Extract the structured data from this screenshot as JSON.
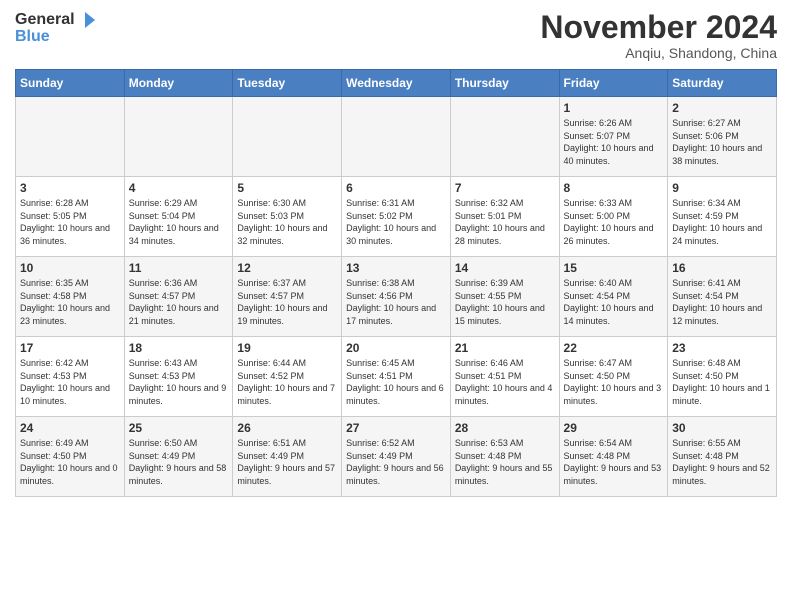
{
  "header": {
    "logo_line1": "General",
    "logo_line2": "Blue",
    "month_title": "November 2024",
    "subtitle": "Anqiu, Shandong, China"
  },
  "days_of_week": [
    "Sunday",
    "Monday",
    "Tuesday",
    "Wednesday",
    "Thursday",
    "Friday",
    "Saturday"
  ],
  "weeks": [
    [
      {
        "day": "",
        "info": ""
      },
      {
        "day": "",
        "info": ""
      },
      {
        "day": "",
        "info": ""
      },
      {
        "day": "",
        "info": ""
      },
      {
        "day": "",
        "info": ""
      },
      {
        "day": "1",
        "info": "Sunrise: 6:26 AM\nSunset: 5:07 PM\nDaylight: 10 hours and 40 minutes."
      },
      {
        "day": "2",
        "info": "Sunrise: 6:27 AM\nSunset: 5:06 PM\nDaylight: 10 hours and 38 minutes."
      }
    ],
    [
      {
        "day": "3",
        "info": "Sunrise: 6:28 AM\nSunset: 5:05 PM\nDaylight: 10 hours and 36 minutes."
      },
      {
        "day": "4",
        "info": "Sunrise: 6:29 AM\nSunset: 5:04 PM\nDaylight: 10 hours and 34 minutes."
      },
      {
        "day": "5",
        "info": "Sunrise: 6:30 AM\nSunset: 5:03 PM\nDaylight: 10 hours and 32 minutes."
      },
      {
        "day": "6",
        "info": "Sunrise: 6:31 AM\nSunset: 5:02 PM\nDaylight: 10 hours and 30 minutes."
      },
      {
        "day": "7",
        "info": "Sunrise: 6:32 AM\nSunset: 5:01 PM\nDaylight: 10 hours and 28 minutes."
      },
      {
        "day": "8",
        "info": "Sunrise: 6:33 AM\nSunset: 5:00 PM\nDaylight: 10 hours and 26 minutes."
      },
      {
        "day": "9",
        "info": "Sunrise: 6:34 AM\nSunset: 4:59 PM\nDaylight: 10 hours and 24 minutes."
      }
    ],
    [
      {
        "day": "10",
        "info": "Sunrise: 6:35 AM\nSunset: 4:58 PM\nDaylight: 10 hours and 23 minutes."
      },
      {
        "day": "11",
        "info": "Sunrise: 6:36 AM\nSunset: 4:57 PM\nDaylight: 10 hours and 21 minutes."
      },
      {
        "day": "12",
        "info": "Sunrise: 6:37 AM\nSunset: 4:57 PM\nDaylight: 10 hours and 19 minutes."
      },
      {
        "day": "13",
        "info": "Sunrise: 6:38 AM\nSunset: 4:56 PM\nDaylight: 10 hours and 17 minutes."
      },
      {
        "day": "14",
        "info": "Sunrise: 6:39 AM\nSunset: 4:55 PM\nDaylight: 10 hours and 15 minutes."
      },
      {
        "day": "15",
        "info": "Sunrise: 6:40 AM\nSunset: 4:54 PM\nDaylight: 10 hours and 14 minutes."
      },
      {
        "day": "16",
        "info": "Sunrise: 6:41 AM\nSunset: 4:54 PM\nDaylight: 10 hours and 12 minutes."
      }
    ],
    [
      {
        "day": "17",
        "info": "Sunrise: 6:42 AM\nSunset: 4:53 PM\nDaylight: 10 hours and 10 minutes."
      },
      {
        "day": "18",
        "info": "Sunrise: 6:43 AM\nSunset: 4:53 PM\nDaylight: 10 hours and 9 minutes."
      },
      {
        "day": "19",
        "info": "Sunrise: 6:44 AM\nSunset: 4:52 PM\nDaylight: 10 hours and 7 minutes."
      },
      {
        "day": "20",
        "info": "Sunrise: 6:45 AM\nSunset: 4:51 PM\nDaylight: 10 hours and 6 minutes."
      },
      {
        "day": "21",
        "info": "Sunrise: 6:46 AM\nSunset: 4:51 PM\nDaylight: 10 hours and 4 minutes."
      },
      {
        "day": "22",
        "info": "Sunrise: 6:47 AM\nSunset: 4:50 PM\nDaylight: 10 hours and 3 minutes."
      },
      {
        "day": "23",
        "info": "Sunrise: 6:48 AM\nSunset: 4:50 PM\nDaylight: 10 hours and 1 minute."
      }
    ],
    [
      {
        "day": "24",
        "info": "Sunrise: 6:49 AM\nSunset: 4:50 PM\nDaylight: 10 hours and 0 minutes."
      },
      {
        "day": "25",
        "info": "Sunrise: 6:50 AM\nSunset: 4:49 PM\nDaylight: 9 hours and 58 minutes."
      },
      {
        "day": "26",
        "info": "Sunrise: 6:51 AM\nSunset: 4:49 PM\nDaylight: 9 hours and 57 minutes."
      },
      {
        "day": "27",
        "info": "Sunrise: 6:52 AM\nSunset: 4:49 PM\nDaylight: 9 hours and 56 minutes."
      },
      {
        "day": "28",
        "info": "Sunrise: 6:53 AM\nSunset: 4:48 PM\nDaylight: 9 hours and 55 minutes."
      },
      {
        "day": "29",
        "info": "Sunrise: 6:54 AM\nSunset: 4:48 PM\nDaylight: 9 hours and 53 minutes."
      },
      {
        "day": "30",
        "info": "Sunrise: 6:55 AM\nSunset: 4:48 PM\nDaylight: 9 hours and 52 minutes."
      }
    ]
  ]
}
